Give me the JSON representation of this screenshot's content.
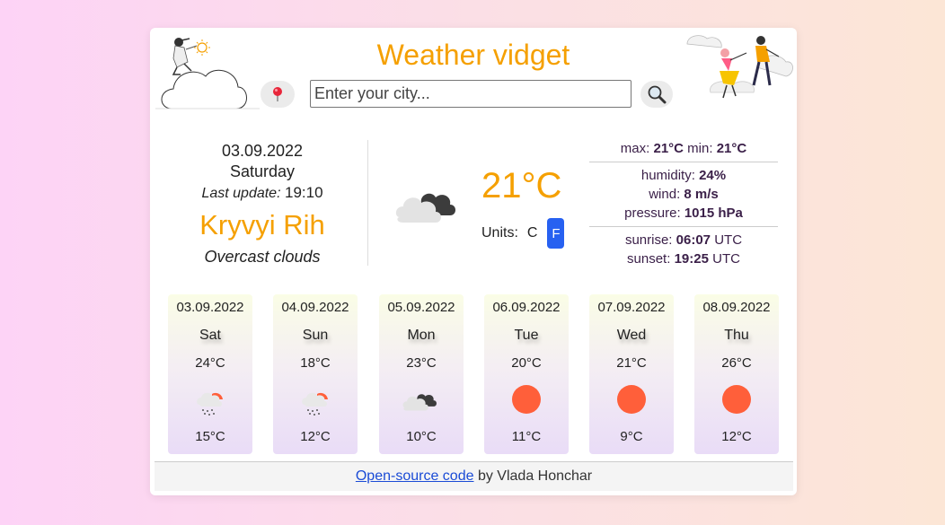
{
  "header": {
    "title": "Weather vidget",
    "search_placeholder": "Enter your city...",
    "location_icon": "map-pin-icon",
    "search_icon": "magnifier-icon"
  },
  "current": {
    "date": "03.09.2022",
    "day": "Saturday",
    "last_update_label": "Last update:",
    "last_update_time": "19:10",
    "city": "Kryvyi Rih",
    "description": "Overcast clouds",
    "temperature": "21°C",
    "icon": "overcast-clouds-icon",
    "units_label": "Units:",
    "unit_c": "C",
    "unit_f": "F"
  },
  "stats": {
    "max_label": "max:",
    "max_value": "21°C",
    "min_label": "min:",
    "min_value": "21°C",
    "humidity_label": "humidity:",
    "humidity_value": "24%",
    "wind_label": "wind:",
    "wind_value": "8 m/s",
    "pressure_label": "pressure:",
    "pressure_value": "1015 hPa",
    "sunrise_label": "sunrise:",
    "sunrise_value": "06:07",
    "sunset_label": "sunset:",
    "sunset_value": "19:25",
    "utc": "UTC"
  },
  "forecast": [
    {
      "date": "03.09.2022",
      "day": "Sat",
      "max": "24°C",
      "min": "15°C",
      "icon": "rain-sun-icon"
    },
    {
      "date": "04.09.2022",
      "day": "Sun",
      "max": "18°C",
      "min": "12°C",
      "icon": "rain-sun-icon"
    },
    {
      "date": "05.09.2022",
      "day": "Mon",
      "max": "23°C",
      "min": "10°C",
      "icon": "overcast-clouds-icon"
    },
    {
      "date": "06.09.2022",
      "day": "Tue",
      "max": "20°C",
      "min": "11°C",
      "icon": "sun-icon"
    },
    {
      "date": "07.09.2022",
      "day": "Wed",
      "max": "21°C",
      "min": "9°C",
      "icon": "sun-icon"
    },
    {
      "date": "08.09.2022",
      "day": "Thu",
      "max": "26°C",
      "min": "12°C",
      "icon": "sun-icon"
    }
  ],
  "footer": {
    "link_text": "Open-source code",
    "by_text": " by Vlada Honchar"
  },
  "colors": {
    "accent": "#f5a000",
    "unit_active": "#2761f1",
    "sun": "#ff5f3a",
    "stats_text": "#3a1f48"
  }
}
